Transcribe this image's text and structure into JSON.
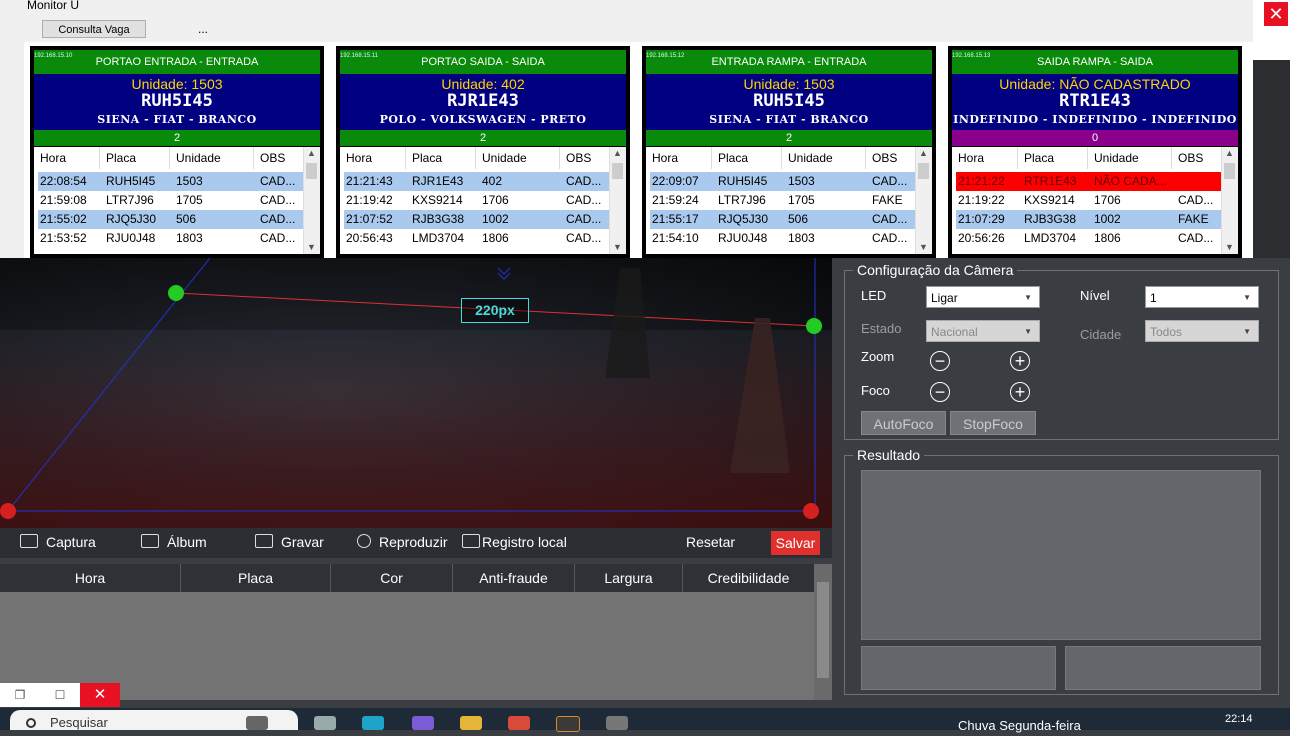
{
  "monitor": {
    "title": "Monitor U",
    "consulta_button": "Consulta Vaga",
    "more": "...",
    "close": "✕",
    "columns": [
      "Hora",
      "Placa",
      "Unidade",
      "OBS"
    ],
    "panels": [
      {
        "ip": "192.168.15.10",
        "header": "PORTAO ENTRADA - ENTRADA",
        "unit": "Unidade: 1503",
        "plate": "RUH5I45",
        "model": "SIENA - FIAT - BRANCO",
        "count": "2",
        "count_color": "#0a8a0a",
        "rows": [
          {
            "hora": "22:08:54",
            "placa": "RUH5I45",
            "unidade": "1503",
            "obs": "CAD..."
          },
          {
            "hora": "21:59:08",
            "placa": "LTR7J96",
            "unidade": "1705",
            "obs": "CAD..."
          },
          {
            "hora": "21:55:02",
            "placa": "RJQ5J30",
            "unidade": "506",
            "obs": "CAD..."
          },
          {
            "hora": "21:53:52",
            "placa": "RJU0J48",
            "unidade": "1803",
            "obs": "CAD..."
          }
        ]
      },
      {
        "ip": "192.168.15.11",
        "header": "PORTAO SAIDA - SAIDA",
        "unit": "Unidade: 402",
        "plate": "RJR1E43",
        "model": "POLO - VOLKSWAGEN - PRETO",
        "count": "2",
        "count_color": "#0a8a0a",
        "rows": [
          {
            "hora": "21:21:43",
            "placa": "RJR1E43",
            "unidade": "402",
            "obs": "CAD..."
          },
          {
            "hora": "21:19:42",
            "placa": "KXS9214",
            "unidade": "1706",
            "obs": "CAD..."
          },
          {
            "hora": "21:07:52",
            "placa": "RJB3G38",
            "unidade": "1002",
            "obs": "CAD..."
          },
          {
            "hora": "20:56:43",
            "placa": "LMD3704",
            "unidade": "1806",
            "obs": "CAD..."
          }
        ]
      },
      {
        "ip": "192.168.15.12",
        "header": "ENTRADA RAMPA - ENTRADA",
        "unit": "Unidade: 1503",
        "plate": "RUH5I45",
        "model": "SIENA - FIAT - BRANCO",
        "count": "2",
        "count_color": "#0a8a0a",
        "rows": [
          {
            "hora": "22:09:07",
            "placa": "RUH5I45",
            "unidade": "1503",
            "obs": "CAD..."
          },
          {
            "hora": "21:59:24",
            "placa": "LTR7J96",
            "unidade": "1705",
            "obs": "FAKE"
          },
          {
            "hora": "21:55:17",
            "placa": "RJQ5J30",
            "unidade": "506",
            "obs": "CAD..."
          },
          {
            "hora": "21:54:10",
            "placa": "RJU0J48",
            "unidade": "1803",
            "obs": "CAD..."
          }
        ]
      },
      {
        "ip": "192.168.15.13",
        "header": "SAIDA RAMPA - SAIDA",
        "unit": "Unidade: NÃO CADASTRADO",
        "plate": "RTR1E43",
        "model": "INDEFINIDO - INDEFINIDO - INDEFINIDO",
        "count": "0",
        "count_color": "#8b008b",
        "rows": [
          {
            "hora": "21:21:22",
            "placa": "RTR1E43",
            "unidade": "NÃO CADA...",
            "obs": ""
          },
          {
            "hora": "21:19:22",
            "placa": "KXS9214",
            "unidade": "1706",
            "obs": "CAD..."
          },
          {
            "hora": "21:07:29",
            "placa": "RJB3G38",
            "unidade": "1002",
            "obs": "FAKE"
          },
          {
            "hora": "20:56:26",
            "placa": "LMD3704",
            "unidade": "1806",
            "obs": "CAD..."
          }
        ]
      }
    ]
  },
  "camera": {
    "measure_label": "220px"
  },
  "toolbar": {
    "captura": "Captura",
    "album": "Álbum",
    "gravar": "Gravar",
    "reproduzir": "Reproduzir",
    "registro": "Registro local",
    "resetar": "Resetar",
    "salvar": "Salvar"
  },
  "results_table": {
    "columns": [
      "Hora",
      "Placa",
      "Cor",
      "Anti-fraude",
      "Largura",
      "Credibilidade"
    ]
  },
  "camera_config": {
    "title": "Configuração da Câmera",
    "led_label": "LED",
    "led_value": "Ligar",
    "nivel_label": "Nível",
    "nivel_value": "1",
    "estado_label": "Estado",
    "estado_value": "Nacional",
    "cidade_label": "Cidade",
    "cidade_value": "Todos",
    "zoom_label": "Zoom",
    "foco_label": "Foco",
    "autofoco": "AutoFoco",
    "stopfoco": "StopFoco"
  },
  "resultado": {
    "title": "Resultado"
  },
  "taskbar": {
    "search": "Pesquisar",
    "weather": "Chuva Segunda-feira",
    "time": "22:14"
  },
  "colors": {
    "header_green": "#0a8a0a",
    "plate_blue": "#000080",
    "unit_yellow": "#ffd700",
    "selected_row": "#a9c9ee",
    "alert_red": "#ff0000",
    "save_red": "#e0302e"
  }
}
